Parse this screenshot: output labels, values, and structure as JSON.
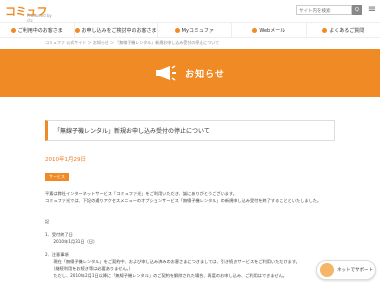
{
  "header": {
    "logo_text": "コミュファ",
    "logo_sub": "Produced by ctc",
    "search_placeholder": "サイト内を検索",
    "search_button": "Q"
  },
  "nav": {
    "items": [
      {
        "label": "ご利用中のお客さま"
      },
      {
        "label": "お申し込みをご検討中のお客さま"
      },
      {
        "label": "Myコミュファ"
      },
      {
        "label": "Webメール"
      },
      {
        "label": "よくあるご質問"
      }
    ]
  },
  "breadcrumb": "コミュファ 公式サイト ＞ お知らせ ＞ 「無線子機レンタル」新規お申し込み受付の停止について",
  "banner": {
    "title": "お知らせ"
  },
  "article": {
    "title": "「無線子機レンタル」新規お申し込み受付の停止について",
    "date": "2010年1月29日",
    "category": "サービス",
    "lines": [
      "平素は弊社インターネットサービス「コミュファ光」をご利用いただき、誠にありがとうございます。",
      "コミュファ光では、下記の通りアクセスメニューのオプションサービス「無線子機レンタル」の新規申し込み受付を終了することといたしました。",
      "",
      "記",
      "1．受付終了日",
      "　　2010年1月31日（日）",
      "2．注意事項",
      "　　現在「無線子機レンタル」をご契約中、および申し込み済みのお客さまにつきましては、引き続きサービスをご利用いただけます。",
      "　　（継続利用をお続き等は必要ありません。）",
      "　　ただし、2010年2月1日以降に「無線子機レンタル」のご契約を解除された場合、再度のお申し込み、ご利用はできません。"
    ]
  },
  "support": {
    "label": "ネットでサポート"
  },
  "colors": {
    "accent": "#f08a24"
  }
}
